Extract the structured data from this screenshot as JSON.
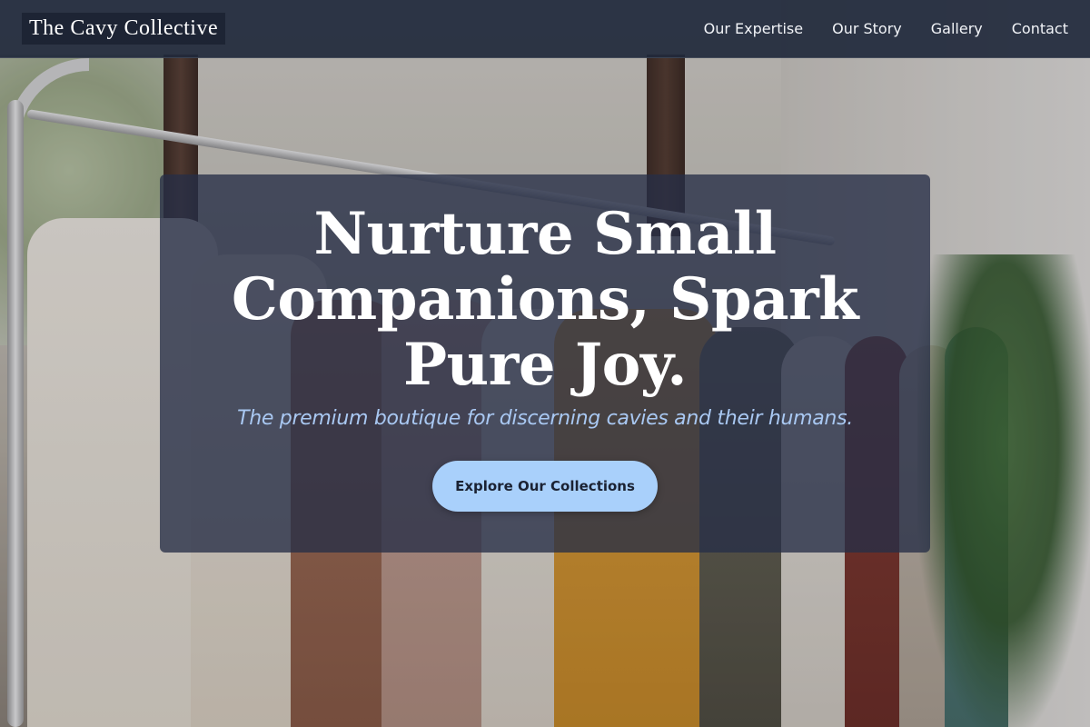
{
  "header": {
    "logo": "The Cavy Collective",
    "nav": [
      {
        "label": "Our Expertise"
      },
      {
        "label": "Our Story"
      },
      {
        "label": "Gallery"
      },
      {
        "label": "Contact"
      }
    ]
  },
  "hero": {
    "title": "Nurture Small Companions, Spark Pure Joy.",
    "subtitle": "The premium boutique for discerning cavies and their humans.",
    "cta_label": "Explore Our Collections",
    "background_image": "clothing-rack-photo"
  },
  "colors": {
    "header_bg": "#21293c",
    "card_bg": "#262e46",
    "subtitle": "#a9c8f2",
    "cta_bg": "#a9d0fb",
    "cta_text": "#1b2233"
  }
}
